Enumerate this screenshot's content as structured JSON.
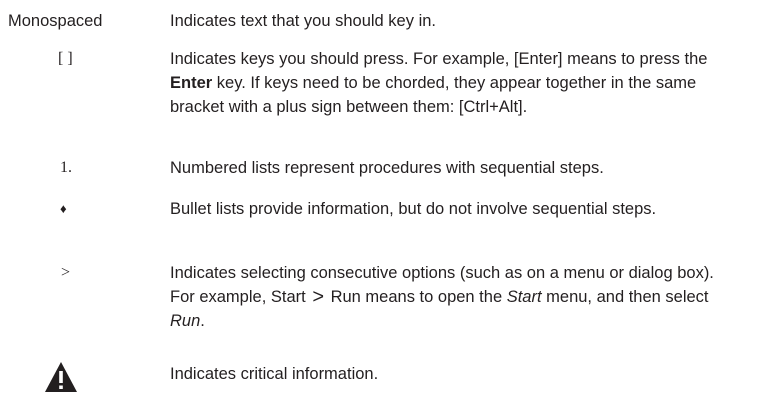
{
  "conventions": [
    {
      "symbol": "Monospaced",
      "text": "Indicates text that you should key in."
    },
    {
      "symbol": "[ ]",
      "parts": [
        "Indicates keys you should press. For example, [Enter] means to press the ",
        "Enter",
        " key. If keys need to be chorded, they appear together in the same bracket with a plus sign between them: [Ctrl+Alt]."
      ]
    },
    {
      "symbol": "1.",
      "text": "Numbered lists represent procedures with sequential steps."
    },
    {
      "symbol": "♦",
      "text": "Bullet lists provide information, but do not involve sequential steps."
    },
    {
      "symbol": ">",
      "parts": [
        "Indicates selecting consecutive options (such as on a menu or dialog box). For example, Start ",
        ">",
        " Run means to open the ",
        "Start",
        " menu, and then select ",
        "Run",
        "."
      ]
    },
    {
      "icon": "warning-triangle-icon",
      "text": "Indicates critical information."
    }
  ]
}
